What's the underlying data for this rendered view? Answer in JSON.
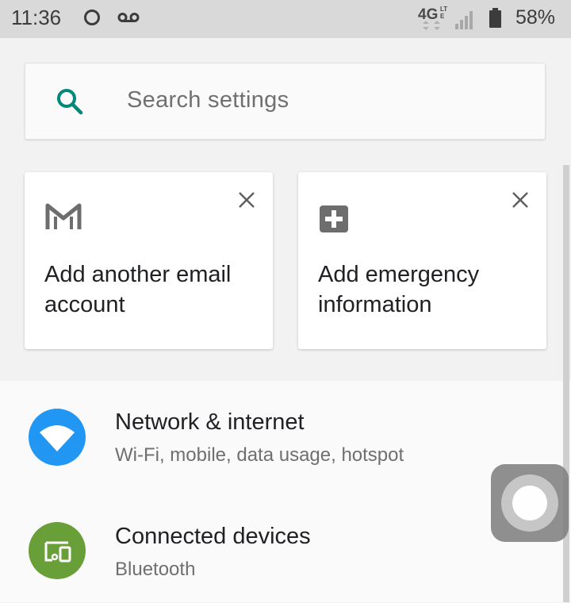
{
  "status_bar": {
    "time": "11:36",
    "battery": "58%",
    "icons": [
      "sync-circle-icon",
      "voicemail-icon",
      "lte-icon",
      "signal-icon",
      "battery-icon"
    ]
  },
  "search": {
    "placeholder": "Search settings",
    "icon": "search-icon",
    "accent_color": "#00897b"
  },
  "suggestions": [
    {
      "icon": "gmail-icon",
      "text": "Add another email account",
      "dismiss_icon": "close-icon"
    },
    {
      "icon": "medical-plus-icon",
      "text": "Add emergency information",
      "dismiss_icon": "close-icon"
    }
  ],
  "settings_items": [
    {
      "icon": "wifi-icon",
      "icon_color": "#2196f3",
      "title": "Network & internet",
      "subtitle": "Wi-Fi, mobile, data usage, hotspot"
    },
    {
      "icon": "devices-icon",
      "icon_color": "#689f38",
      "title": "Connected devices",
      "subtitle": "Bluetooth"
    }
  ],
  "floating_button": {
    "icon": "assistive-touch-icon"
  }
}
